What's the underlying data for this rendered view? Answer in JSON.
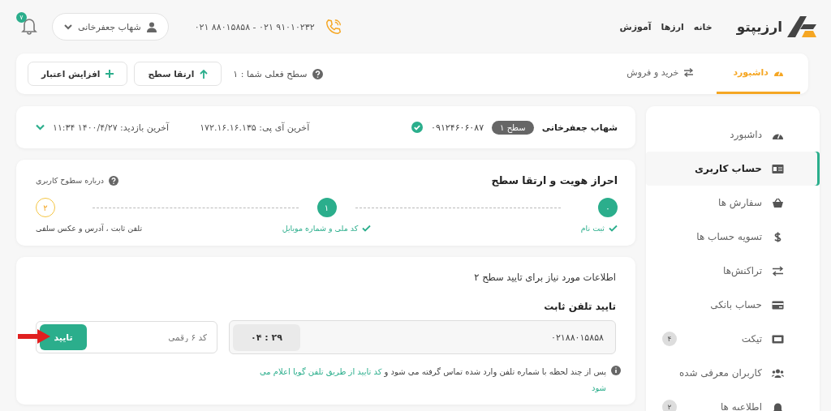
{
  "header": {
    "logo": "ارزیپتو",
    "nav": [
      "خانه",
      "ارزها",
      "آموزش"
    ],
    "phones": "۰۲۱ ۸۸۰۱۵۸۵۸ - ۰۲۱ ۹۱۰۱۰۲۳۲",
    "user": "شهاب جعفرخانی",
    "notifications": "۷"
  },
  "tabs": [
    {
      "label": "داشبورد",
      "selected": true
    },
    {
      "label": "خرید و فروش",
      "selected": false
    }
  ],
  "level_info": "سطح فعلی شما : ۱",
  "actions": [
    "ارتقا سطح",
    "افزایش اعتبار"
  ],
  "sidebar": [
    {
      "label": "داشبورد",
      "selected": false
    },
    {
      "label": "حساب کاربری",
      "selected": true
    },
    {
      "label": "سفارش ها",
      "selected": false
    },
    {
      "label": "تسویه حساب ها",
      "selected": false
    },
    {
      "label": "تراکنش‌ها",
      "selected": false
    },
    {
      "label": "حساب بانکی",
      "selected": false
    },
    {
      "label": "تیکت",
      "selected": false,
      "badge": "۴"
    },
    {
      "label": "کاربران معرفی شده",
      "selected": false
    },
    {
      "label": "اطلاعیه ها",
      "selected": false,
      "badge": "۲"
    }
  ],
  "profile": {
    "name": "شهاب جعفرخانی",
    "level": "سطح ۱",
    "mobile": "۰۹۱۲۴۶۰۶۰۸۷",
    "verified": true,
    "last_ip": "آخرین آی پی: ۱۷۲.۱۶.۱۶.۱۳۵",
    "last_visit": "آخرین بازدید: ۱۴۰۰/۴/۲۷ ۱۱:۳۴"
  },
  "verification": {
    "title": "احراز هویت و ارتقا سطح",
    "help": "درباره سطوح کاربری",
    "steps": [
      {
        "number": "۰",
        "label": "ثبت نام",
        "done": true
      },
      {
        "number": "۱",
        "label": "کد ملی و شماره موبایل",
        "done": true
      },
      {
        "number": "۲",
        "label": "تلفن ثابت ، آدرس و عکس سلفی",
        "done": false
      }
    ]
  },
  "form": {
    "heading": "اطلاعات مورد نیاز برای تایید سطح ۲",
    "section": "تایید تلفن ثابت",
    "phone": "۰۲۱۸۸۰۱۵۸۵۸",
    "timer": "۰۴ : ۲۹",
    "code_placeholder": "کد ۶ رقمی",
    "submit": "تایید",
    "note": {
      "text": "پس از چند لحظه با شماره تلفن وارد شده تماس گرفته می شود و",
      "highlight": "کد تایید از طریق تلفن گویا اعلام می شود"
    }
  }
}
